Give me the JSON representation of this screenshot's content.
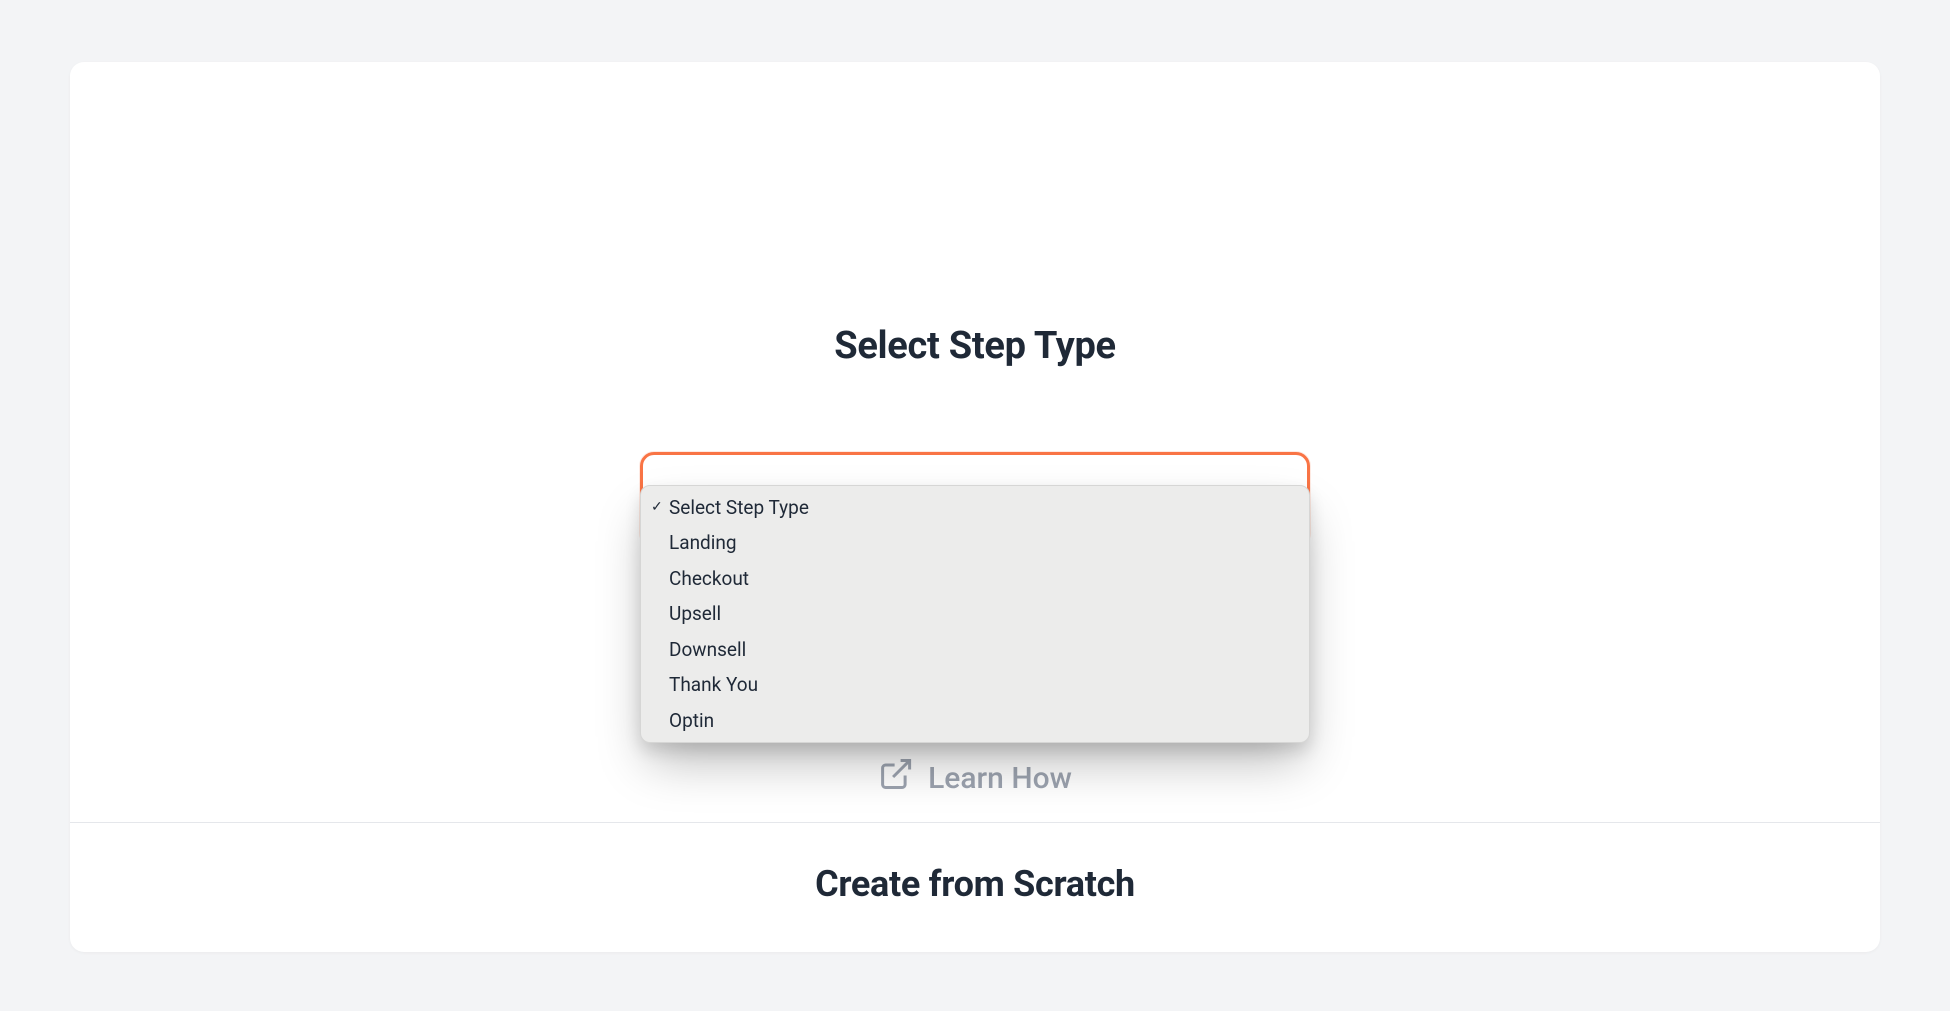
{
  "section_top": {
    "heading": "Select Step Type",
    "select": {
      "placeholder": "Select Step Type",
      "selected_index": 0,
      "options": [
        "Select Step Type",
        "Landing",
        "Checkout",
        "Upsell",
        "Downsell",
        "Thank You",
        "Optin"
      ]
    },
    "learn_how_label": "Learn How"
  },
  "section_bottom": {
    "heading": "Create from Scratch"
  }
}
